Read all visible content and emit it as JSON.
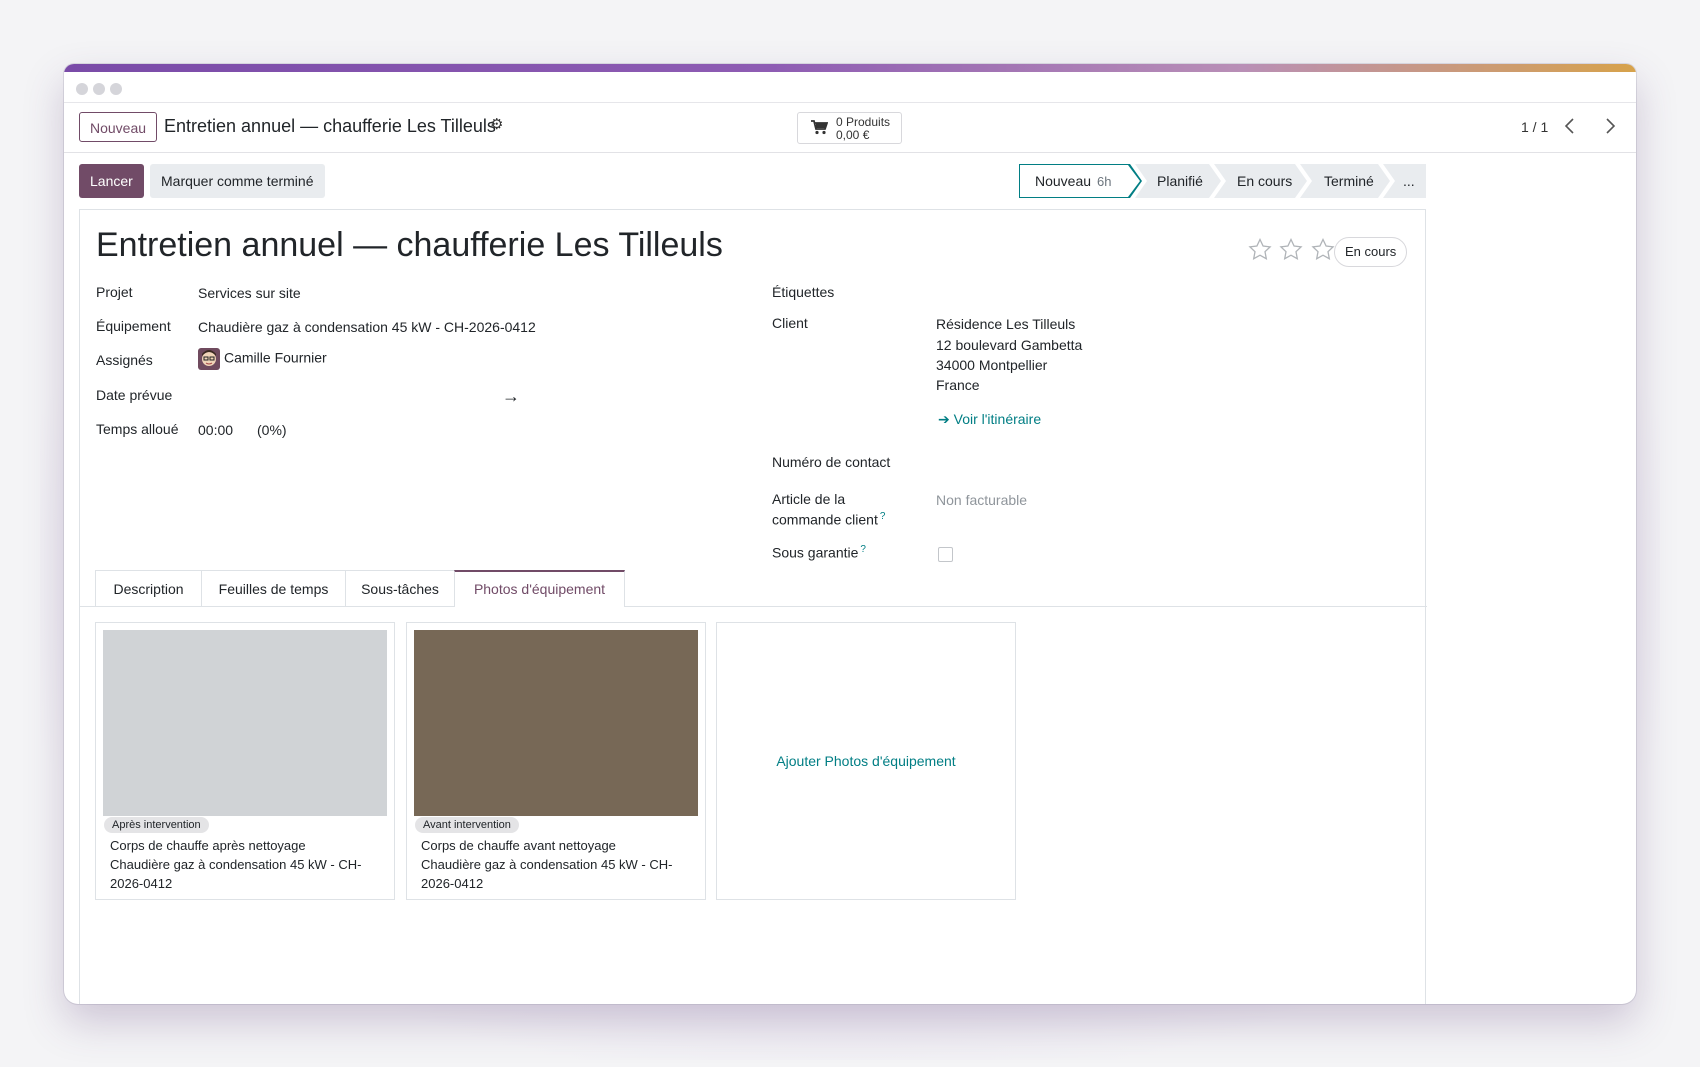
{
  "control_bar": {
    "new_button": "Nouveau",
    "breadcrumb_title": "Entretien annuel — chaufferie Les Tilleuls",
    "products_label": "0 Produits",
    "products_amount": "0,00 €",
    "pager": "1 / 1"
  },
  "actions": {
    "start_button": "Lancer",
    "mark_done_button": "Marquer comme terminé"
  },
  "statusbar": {
    "stages": [
      {
        "label": "Nouveau",
        "count": "6h",
        "active": true
      },
      {
        "label": "Planifié"
      },
      {
        "label": "En cours"
      },
      {
        "label": "Terminé"
      },
      {
        "label": "..."
      }
    ]
  },
  "form": {
    "title": "Entretien annuel — chaufferie Les Tilleuls",
    "state": "En cours",
    "stars_filled": 0,
    "stars_total": 3,
    "left": {
      "project_label": "Projet",
      "project_value": "Services sur site",
      "equipment_label": "Équipement",
      "equipment_value": "Chaudière gaz à condensation 45 kW - CH-2026-0412",
      "assignees_label": "Assignés",
      "assignee_name": "Camille Fournier",
      "planned_date_label": "Date prévue",
      "allocated_time_label": "Temps alloué",
      "allocated_time_value": "00:00",
      "allocated_time_percent": "(0%)"
    },
    "right": {
      "tags_label": "Étiquettes",
      "customer_label": "Client",
      "customer_address": [
        "Résidence Les Tilleuls",
        "12 boulevard Gambetta",
        "34000 Montpellier",
        "France"
      ],
      "route_link": "Voir l'itinéraire",
      "contact_number_label": "Numéro de contact",
      "sale_line_label_1": "Article de la",
      "sale_line_label_2": "commande client",
      "sale_line_value": "Non facturable",
      "warranty_label": "Sous garantie",
      "tooltip_mark": "?"
    }
  },
  "tabs": [
    {
      "label": "Description"
    },
    {
      "label": "Feuilles de temps"
    },
    {
      "label": "Sous-tâches"
    },
    {
      "label": "Photos d'équipement",
      "active": true
    }
  ],
  "photos": [
    {
      "badge": "Après intervention",
      "caption": "Corps de chauffe après nettoyage",
      "equipment_line1": "Chaudière gaz à condensation 45 kW - CH-",
      "equipment_line2": "2026-0412",
      "color": "#d0d3d6"
    },
    {
      "badge": "Avant intervention",
      "caption": "Corps de chauffe avant nettoyage",
      "equipment_line1": "Chaudière gaz à condensation 45 kW - CH-",
      "equipment_line2": "2026-0412",
      "color": "#776856"
    }
  ],
  "add_photo_link": "Ajouter Photos d'équipement",
  "colors": {
    "brand": "#714b67",
    "link": "#017e84"
  }
}
